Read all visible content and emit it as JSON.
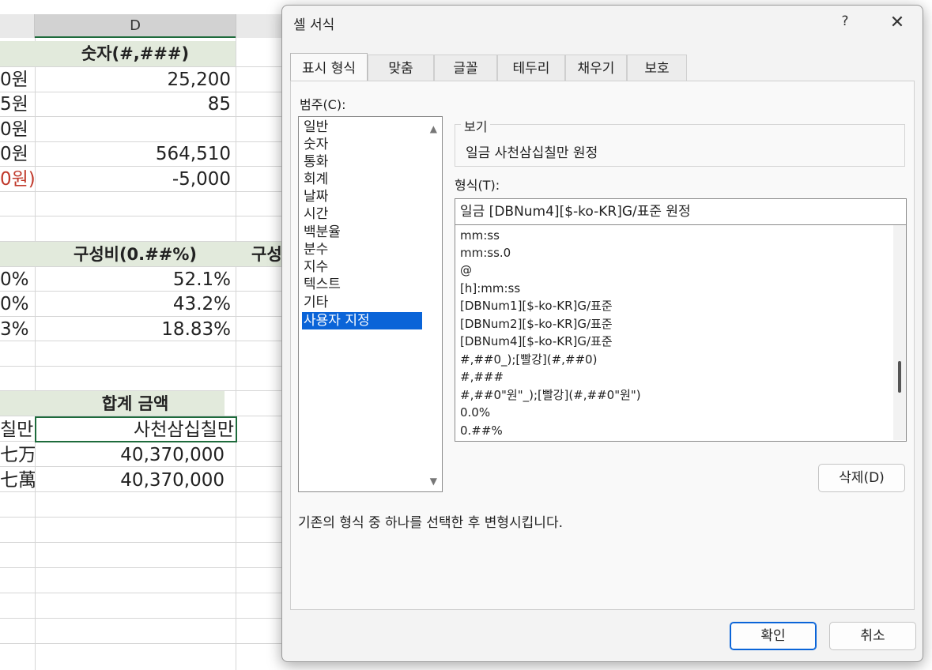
{
  "sheet": {
    "column_header": "D",
    "block1": {
      "header": "숫자(#,###)",
      "left_fragments": [
        "0원",
        "5원",
        "0원",
        "0원",
        "0원)"
      ],
      "values": [
        "25,200",
        "85",
        "",
        "564,510",
        "-5,000"
      ]
    },
    "block2": {
      "header": "구성비(0.##%)",
      "right_header_fragment": "구성",
      "left_fragments": [
        "0%",
        "0%",
        "3%"
      ],
      "values": [
        "52.1%",
        "43.2%",
        "18.83%"
      ]
    },
    "block3": {
      "header": "합계 금액",
      "left_fragments": [
        "칠만",
        "七万",
        "七萬"
      ],
      "values": [
        "사천삼십칠만",
        "40,370,000",
        "40,370,000"
      ]
    },
    "colors": {
      "header_band": "#e2eadc",
      "selection": "#1e6b3c",
      "negative": "#c0392b"
    }
  },
  "dialog": {
    "title": "셀 서식",
    "help": "?",
    "close": "✕",
    "tabs": [
      "표시 형식",
      "맞춤",
      "글꼴",
      "테두리",
      "채우기",
      "보호"
    ],
    "active_tab": "표시 형식",
    "category_label": "범주(C):",
    "categories": [
      "일반",
      "숫자",
      "통화",
      "회계",
      "날짜",
      "시간",
      "백분율",
      "분수",
      "지수",
      "텍스트",
      "기타",
      "사용자 지정"
    ],
    "selected_category": "사용자 지정",
    "preview_label": "보기",
    "preview_value": "일금 사천삼십칠만 원정",
    "format_label": "형식(T):",
    "format_value": "일금 [DBNum4][$-ko-KR]G/표준 원정",
    "format_list": [
      "mm:ss",
      "mm:ss.0",
      "@",
      "[h]:mm:ss",
      "[DBNum1][$-ko-KR]G/표준",
      "[DBNum2][$-ko-KR]G/표준",
      "[DBNum4][$-ko-KR]G/표준",
      "#,##0_);[빨강](#,##0)",
      "#,###",
      "#,##0\"원\"_);[빨강](#,##0\"원\")",
      "0.0%",
      "0.##%"
    ],
    "delete_button": "삭제(D)",
    "description": "기존의 형식 중 하나를 선택한 후 변형시킵니다.",
    "ok_button": "확인",
    "cancel_button": "취소",
    "accent_color": "#0a64d8"
  }
}
